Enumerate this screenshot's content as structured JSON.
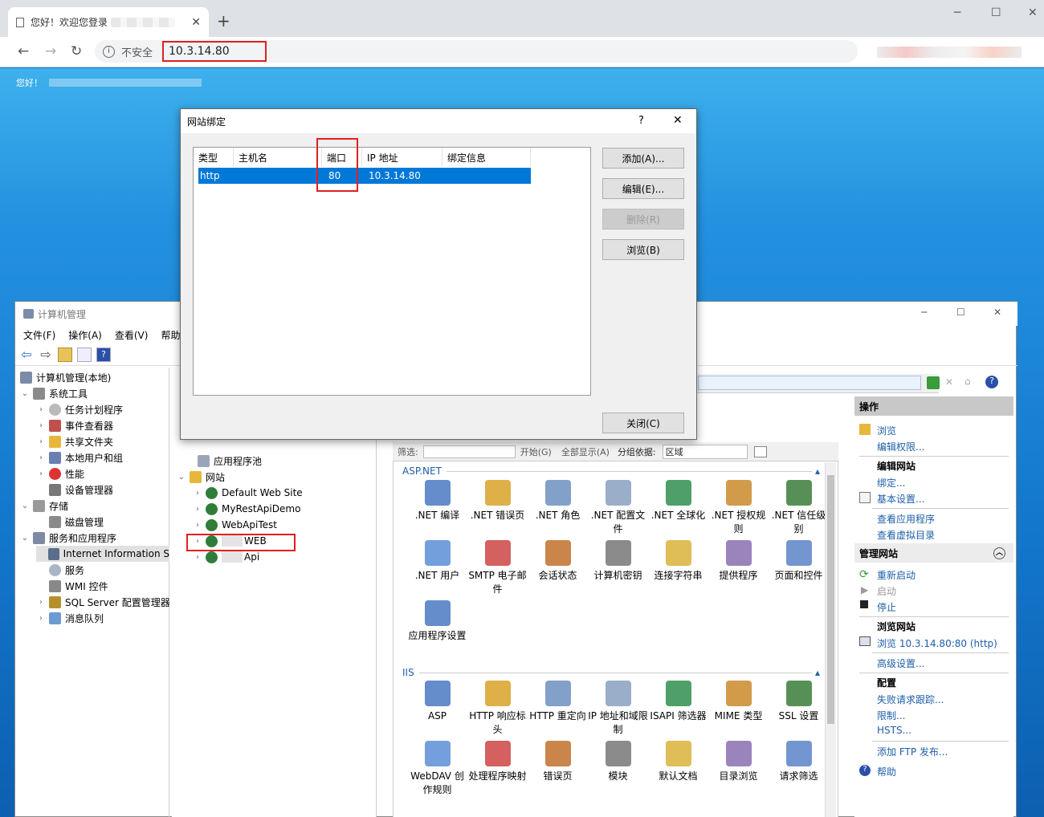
{
  "browser": {
    "tab_title": "您好！欢迎您登录",
    "new_tab": "+",
    "insecure_label": "不安全",
    "url": "10.3.14.80",
    "window_controls": {
      "minimize": "─",
      "maximize": "☐",
      "close": "✕"
    }
  },
  "page": {
    "greeting": "您好！"
  },
  "cm": {
    "title": "计算机管理",
    "menu": [
      "文件(F)",
      "操作(A)",
      "查看(V)",
      "帮助("
    ],
    "window_controls": {
      "minimize": "─",
      "maximize": "☐",
      "close": "✕"
    },
    "tree": [
      {
        "label": "计算机管理(本地)",
        "chev": "",
        "level": 0
      },
      {
        "label": "系统工具",
        "chev": "⌄",
        "level": 1
      },
      {
        "label": "任务计划程序",
        "chev": "›",
        "level": 2
      },
      {
        "label": "事件查看器",
        "chev": "›",
        "level": 2
      },
      {
        "label": "共享文件夹",
        "chev": "›",
        "level": 2
      },
      {
        "label": "本地用户和组",
        "chev": "›",
        "level": 2
      },
      {
        "label": "性能",
        "chev": "›",
        "level": 2
      },
      {
        "label": "设备管理器",
        "chev": "",
        "level": 2
      },
      {
        "label": "存储",
        "chev": "⌄",
        "level": 1
      },
      {
        "label": "磁盘管理",
        "chev": "",
        "level": 2
      },
      {
        "label": "服务和应用程序",
        "chev": "⌄",
        "level": 1
      },
      {
        "label": "Internet Information S",
        "chev": "",
        "level": 2
      },
      {
        "label": "服务",
        "chev": "",
        "level": 2
      },
      {
        "label": "WMI 控件",
        "chev": "",
        "level": 2
      },
      {
        "label": "SQL Server 配置管理器",
        "chev": "›",
        "level": 2
      },
      {
        "label": "消息队列",
        "chev": "›",
        "level": 2
      }
    ],
    "sites_tree": [
      {
        "label": "应用程序池",
        "chev": ""
      },
      {
        "label": "网站",
        "chev": "⌄"
      },
      {
        "label": "Default Web Site",
        "chev": "›"
      },
      {
        "label": "MyRestApiDemo",
        "chev": "›"
      },
      {
        "label": "WebApiTest",
        "chev": "›"
      },
      {
        "label": "WEB",
        "chev": "›"
      },
      {
        "label": "Api",
        "chev": "›"
      }
    ],
    "filter": {
      "label": "筛选:",
      "start": "开始(G)",
      "show_all": "全部显示(A)",
      "group_by": "分组依据:",
      "group_value": "区域"
    },
    "aspnet_section": "ASP.NET",
    "aspnet_features": [
      ".NET 编译",
      ".NET 错误页",
      ".NET 角色",
      ".NET 配置文件",
      ".NET 全球化",
      ".NET 授权规则",
      ".NET 信任级别",
      ".NET 用户",
      "SMTP 电子邮件",
      "会话状态",
      "计算机密钥",
      "连接字符串",
      "提供程序",
      "页面和控件",
      "应用程序设置"
    ],
    "iis_section": "IIS",
    "iis_features": [
      "ASP",
      "HTTP 响应标头",
      "HTTP 重定向",
      "IP 地址和域限制",
      "ISAPI 筛选器",
      "MIME 类型",
      "SSL 设置",
      "WebDAV 创作规则",
      "处理程序映射",
      "错误页",
      "模块",
      "默认文档",
      "目录浏览",
      "请求筛选"
    ],
    "actions": {
      "header": "操作",
      "browse": "浏览",
      "edit_perms": "编辑权限...",
      "edit_site": "编辑网站",
      "bindings": "绑定...",
      "basic_settings": "基本设置...",
      "view_apps": "查看应用程序",
      "view_vdirs": "查看虚拟目录",
      "manage_site": "管理网站",
      "restart": "重新启动",
      "start": "启动",
      "stop": "停止",
      "browse_site": "浏览网站",
      "browse_url": "浏览 10.3.14.80:80 (http)",
      "advanced": "高级设置...",
      "config": "配置",
      "failed_trace": "失败请求跟踪...",
      "limits": "限制...",
      "hsts": "HSTS...",
      "add_ftp": "添加 FTP 发布...",
      "help": "帮助"
    }
  },
  "dialog": {
    "title": "网站绑定",
    "help": "?",
    "close": "✕",
    "columns": [
      "类型",
      "主机名",
      "端口",
      "IP 地址",
      "绑定信息"
    ],
    "rows": [
      {
        "type": "http",
        "host": "",
        "port": "80",
        "ip": "10.3.14.80",
        "info": ""
      }
    ],
    "buttons": {
      "add": "添加(A)...",
      "edit": "编辑(E)...",
      "remove": "删除(R)",
      "browse": "浏览(B)",
      "close": "关闭(C)"
    }
  }
}
